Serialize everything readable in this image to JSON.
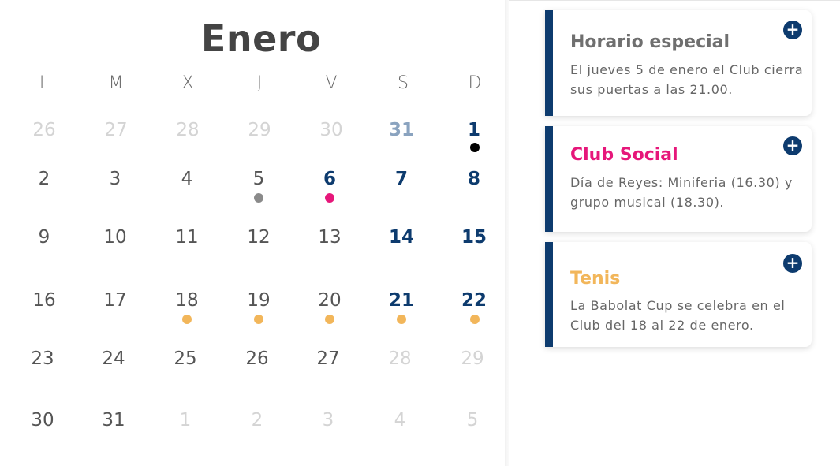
{
  "calendar": {
    "month": "Enero",
    "weekdays": [
      "L",
      "M",
      "X",
      "J",
      "V",
      "S",
      "D"
    ],
    "weeks": [
      [
        "26",
        "27",
        "28",
        "29",
        "30",
        "31",
        "1"
      ],
      [
        "2",
        "3",
        "4",
        "5",
        "6",
        "7",
        "8"
      ],
      [
        "9",
        "10",
        "11",
        "12",
        "13",
        "14",
        "15"
      ],
      [
        "16",
        "17",
        "18",
        "19",
        "20",
        "21",
        "22"
      ],
      [
        "23",
        "24",
        "25",
        "26",
        "27",
        "28",
        "29"
      ],
      [
        "30",
        "31",
        "1",
        "2",
        "3",
        "4",
        "5"
      ]
    ]
  },
  "colors": {
    "primary": "#0d3b6e",
    "club_social": "#e6177a",
    "tenis": "#f2b65a",
    "special": "#000000",
    "gray_dot": "#8a8a8a"
  },
  "events": [
    {
      "title": "Horario especial",
      "text": "El jueves 5 de enero el Club cierra sus puertas a las 21.00.",
      "icon": "plus-circle-icon"
    },
    {
      "title": "Club Social",
      "text": "Día de Reyes: Miniferia (16.30) y grupo musical (18.30).",
      "icon": "plus-circle-icon"
    },
    {
      "title": "Tenis",
      "text": "La Babolat Cup se celebra en el Club del 18 al 22 de enero.",
      "icon": "plus-circle-icon"
    }
  ]
}
